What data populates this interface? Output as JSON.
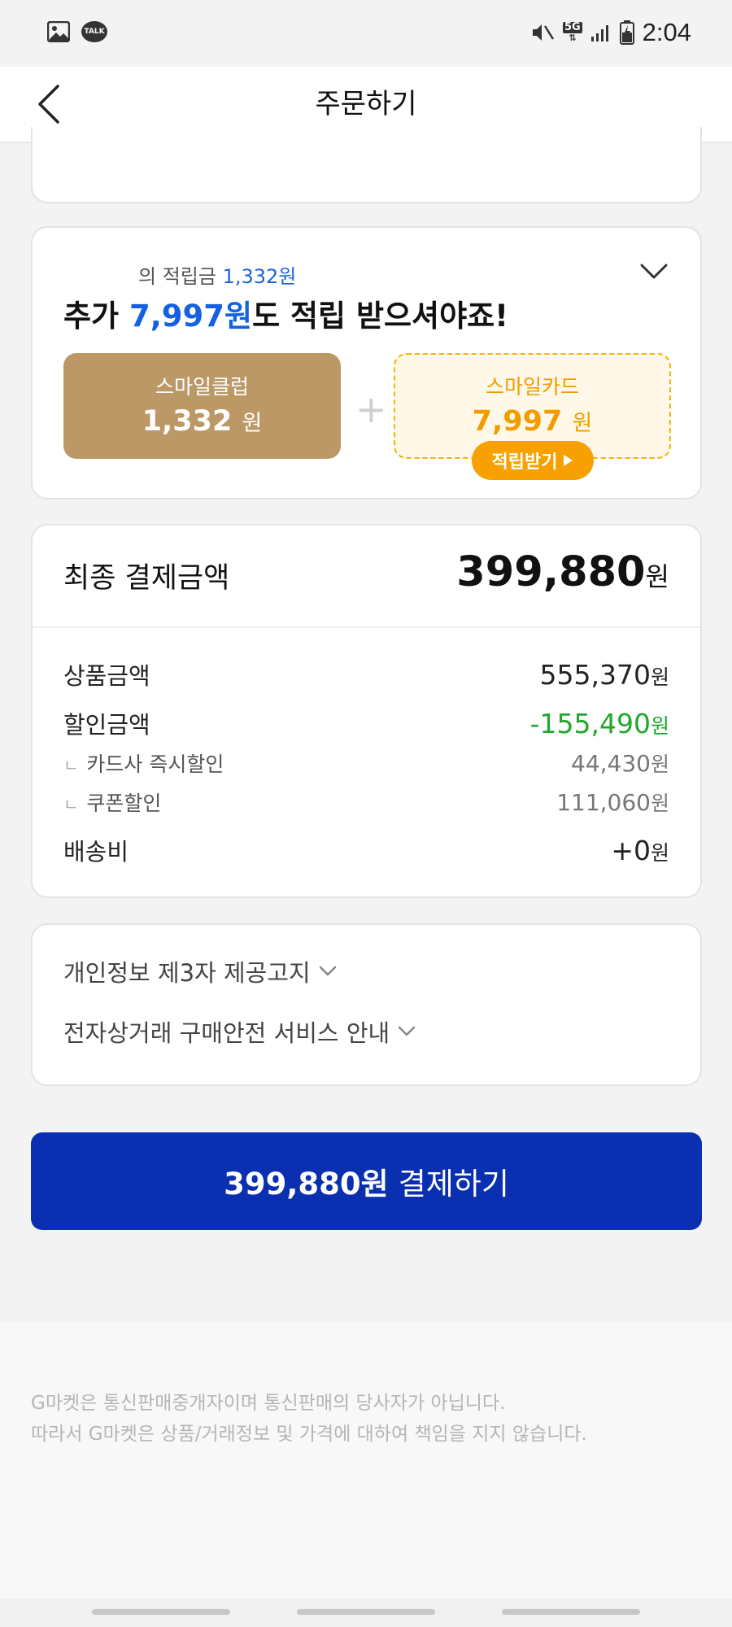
{
  "status_bar": {
    "time": "2:04",
    "network": "5G",
    "icons": [
      "gallery-icon",
      "talk-icon",
      "mute-vibrate-icon",
      "5g-icon",
      "signal-icon",
      "battery-charging-icon"
    ],
    "talk_label": "TALK"
  },
  "header": {
    "title": "주문하기",
    "back_icon": "chevron-left-icon"
  },
  "reward": {
    "sub_prefix": "의 적립금",
    "sub_amount": "1,332원",
    "headline_prefix": "추가",
    "headline_amount": "7,997원",
    "headline_suffix": "도 적립 받으셔야죠!",
    "club_label": "스마일클럽",
    "club_amount": "1,332",
    "card_label": "스마일카드",
    "card_amount": "7,997",
    "unit": "원",
    "save_button": "적립받기",
    "colors": {
      "club_bg": "#bb9866",
      "card_accent": "#f39c00",
      "blue": "#1560e3"
    }
  },
  "totals": {
    "final_label": "최종 결제금액",
    "final_amount": "399,880",
    "unit": "원",
    "rows": [
      {
        "label": "상품금액",
        "value": "555,370"
      },
      {
        "label": "할인금액",
        "value": "-155,490"
      },
      {
        "label": "카드사 즉시할인",
        "value": "44,430"
      },
      {
        "label": "쿠폰할인",
        "value": "111,060"
      },
      {
        "label": "배송비",
        "value": "+0"
      }
    ],
    "discount_color": "#20a72c"
  },
  "notices": [
    {
      "label": "개인정보 제3자 제공고지"
    },
    {
      "label": "전자상거래 구매안전 서비스 안내"
    }
  ],
  "pay_button": {
    "amount": "399,880원",
    "label": "결제하기",
    "color": "#0a2fb0"
  },
  "footer": {
    "line1": "G마켓은 통신판매중개자이며 통신판매의 당사자가 아닙니다.",
    "line2": "따라서 G마켓은 상품/거래정보 및 가격에 대하여 책임을 지지 않습니다."
  }
}
